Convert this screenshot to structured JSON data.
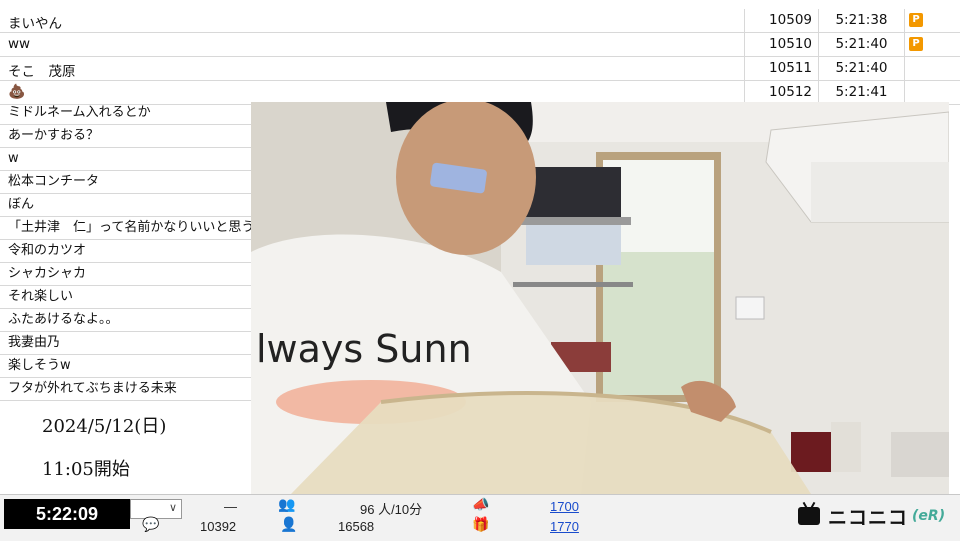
{
  "top_comments": [
    {
      "text": "まいやん",
      "number": "10509",
      "time": "5:21:38",
      "premium": "P"
    },
    {
      "text": "ww",
      "number": "10510",
      "time": "5:21:40",
      "premium": "P"
    },
    {
      "text": "そこ　茂原",
      "number": "10511",
      "time": "5:21:40",
      "premium": ""
    },
    {
      "text": "💩",
      "number": "10512",
      "time": "5:21:41",
      "premium": ""
    }
  ],
  "left_comments": [
    "ミドルネーム入れるとか",
    "あーかすおる？",
    "w",
    "松本コンチータ",
    "ぼん",
    "「土井津　仁」って名前かなりいいと思う",
    "令和のカツオ",
    "シャカシャカ",
    "それ楽しい",
    "ふたあけるなよ。。",
    "我妻由乃",
    "楽しそうw",
    "フタが外れてぶちまける未来"
  ],
  "info": {
    "date": "2024/5/12(日)",
    "start": "11:05開始"
  },
  "video": {
    "shirt_text": "lways Sunn"
  },
  "bottom_bar": {
    "elapsed": "5:22:09",
    "dash": "—",
    "count_a": "10392",
    "viewers": "96 人/10分",
    "count_b": "16568",
    "link_1": "1700",
    "link_2": "1770",
    "logo_text": "ニコニコ",
    "logo_suffix": "(eR)"
  },
  "colors": {
    "premium_badge": "#f39800",
    "link": "#1a4ccc",
    "timer_bg": "#000000"
  }
}
